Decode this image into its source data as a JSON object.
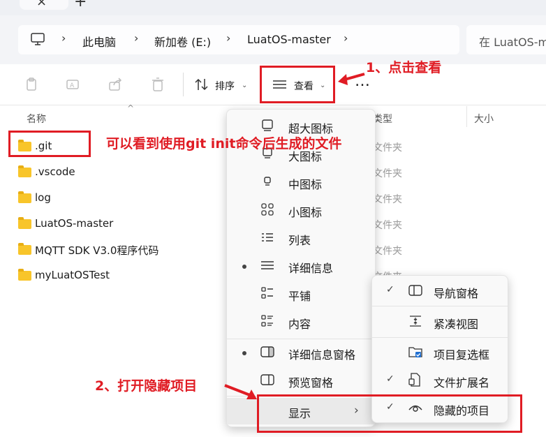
{
  "window": {
    "tab_close": "×",
    "new_tab": "+"
  },
  "address": {
    "computer_icon": "computer-icon",
    "crumbs": [
      "此电脑",
      "新加卷 (E:)",
      "LuatOS-master"
    ],
    "separator": "›",
    "search_placeholder": "在 LuatOS-m"
  },
  "toolbar": {
    "sort_label": "排序",
    "view_label": "查看",
    "more_label": "…",
    "chevron": "⌄"
  },
  "columns": {
    "name": "名称",
    "type": "类型",
    "size": "大小",
    "sort_arrow": "^"
  },
  "files": [
    {
      "name": ".git",
      "type": "文件夹"
    },
    {
      "name": ".vscode",
      "type": "文件夹"
    },
    {
      "name": "log",
      "type": "文件夹"
    },
    {
      "name": "LuatOS-master",
      "type": "文件夹"
    },
    {
      "name": "MQTT SDK V3.0程序代码",
      "type": "文件夹"
    },
    {
      "name": "myLuatOSTest",
      "type": "文件夹"
    }
  ],
  "view_menu": {
    "items": [
      {
        "label": "超大图标",
        "icon": "extra-large-icons-icon"
      },
      {
        "label": "大图标",
        "icon": "large-icons-icon"
      },
      {
        "label": "中图标",
        "icon": "medium-icons-icon"
      },
      {
        "label": "小图标",
        "icon": "small-icons-icon"
      },
      {
        "label": "列表",
        "icon": "list-icon"
      },
      {
        "label": "详细信息",
        "icon": "details-icon",
        "selected": true
      },
      {
        "label": "平铺",
        "icon": "tiles-icon"
      },
      {
        "label": "内容",
        "icon": "content-icon"
      },
      {
        "label": "详细信息窗格",
        "icon": "details-pane-icon",
        "selected": true
      },
      {
        "label": "预览窗格",
        "icon": "preview-pane-icon"
      },
      {
        "label": "显示",
        "icon": "",
        "has_submenu": true
      }
    ],
    "submenu_arrow": "›"
  },
  "show_submenu": {
    "items": [
      {
        "label": "导航窗格",
        "checked": true,
        "icon": "navigation-pane-icon"
      },
      {
        "label": "紧凑视图",
        "checked": false,
        "icon": "compact-view-icon"
      },
      {
        "label": "项目复选框",
        "checked": false,
        "icon": "item-checkbox-icon"
      },
      {
        "label": "文件扩展名",
        "checked": true,
        "icon": "file-extension-icon"
      },
      {
        "label": "隐藏的项目",
        "checked": true,
        "icon": "hidden-items-icon"
      }
    ],
    "check_mark": "✓"
  },
  "annotations": {
    "step1": "1、点击查看",
    "git_note": "可以看到使用git init命令后生成的文件",
    "step2": "2、打开隐藏项目",
    "color": "#e01c24"
  }
}
